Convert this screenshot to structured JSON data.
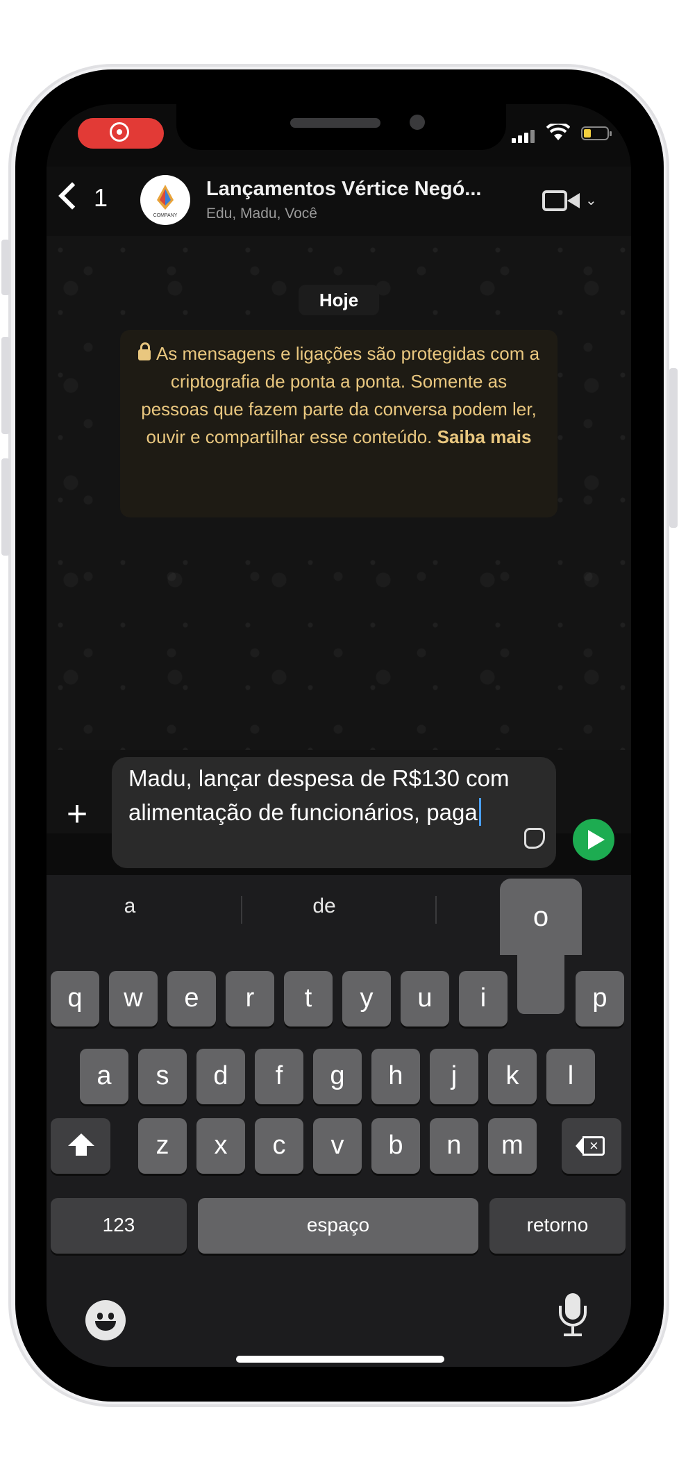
{
  "status_bar": {
    "recording_indicator": "screen-recording",
    "icons": [
      "signal-icon",
      "wifi-icon",
      "battery-icon"
    ]
  },
  "header": {
    "back_count": "1",
    "avatar_label": "COMPANY",
    "title": "Lançamentos Vértice Negó...",
    "members": "Edu, Madu, Você",
    "video_chevron": "⌄"
  },
  "chat": {
    "date_label": "Hoje",
    "encryption_notice": "As mensagens e ligações são protegidas com a criptografia de ponta a ponta. Somente as pessoas que fazem parte da conversa podem ler, ouvir e compartilhar esse conteúdo.",
    "learn_more": "Saiba mais"
  },
  "composer": {
    "plus_label": "+",
    "message_text": "Madu, lançar despesa de R$130 com alimentação de funcionários, paga"
  },
  "keyboard": {
    "suggestions": [
      "a",
      "de",
      ""
    ],
    "popup_key": "o",
    "row1": [
      "q",
      "w",
      "e",
      "r",
      "t",
      "y",
      "u",
      "i",
      "o",
      "p"
    ],
    "row2": [
      "a",
      "s",
      "d",
      "f",
      "g",
      "h",
      "j",
      "k",
      "l"
    ],
    "row3": [
      "z",
      "x",
      "c",
      "v",
      "b",
      "n",
      "m"
    ],
    "numbers_key": "123",
    "space_key": "espaço",
    "return_key": "retorno"
  },
  "colors": {
    "send_button": "#1dac51",
    "encryption_text": "#e9c77f",
    "recording": "#e23a36"
  }
}
